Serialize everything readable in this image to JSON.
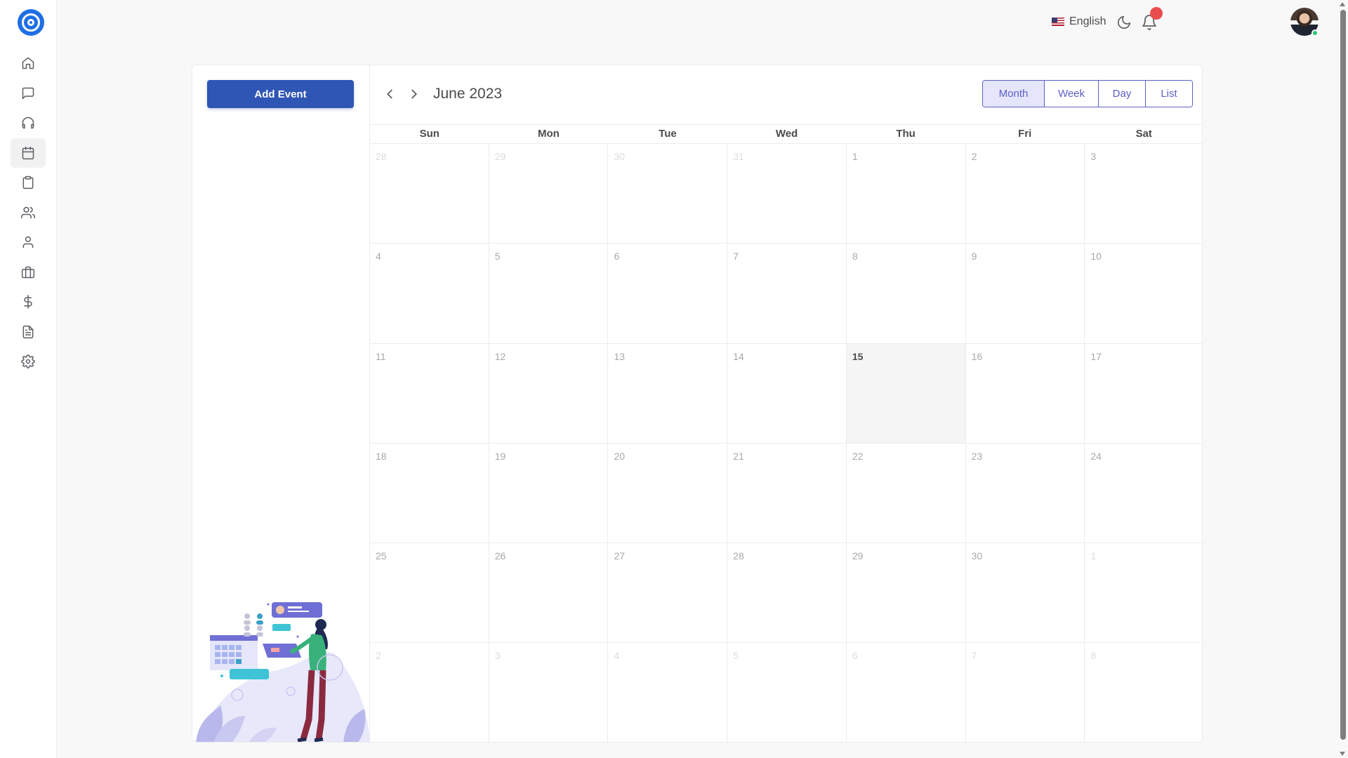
{
  "sidebar": {
    "items": [
      {
        "icon": "home-icon",
        "active": false
      },
      {
        "icon": "chat-icon",
        "active": false
      },
      {
        "icon": "headphones-icon",
        "active": false
      },
      {
        "icon": "calendar-icon",
        "active": true
      },
      {
        "icon": "clipboard-icon",
        "active": false
      },
      {
        "icon": "users-icon",
        "active": false
      },
      {
        "icon": "user-icon",
        "active": false
      },
      {
        "icon": "briefcase-icon",
        "active": false
      },
      {
        "icon": "dollar-icon",
        "active": false
      },
      {
        "icon": "file-text-icon",
        "active": false
      },
      {
        "icon": "settings-icon",
        "active": false
      }
    ]
  },
  "header": {
    "language": "English",
    "colors": {
      "notification_badge": "#ea4d4d",
      "online_status": "#28c76f"
    }
  },
  "left_panel": {
    "add_event_label": "Add Event",
    "colors": {
      "primary_button": "#2f55b5"
    }
  },
  "calendar": {
    "title": "June 2023",
    "views": [
      {
        "label": "Month",
        "active": true
      },
      {
        "label": "Week",
        "active": false
      },
      {
        "label": "Day",
        "active": false
      },
      {
        "label": "List",
        "active": false
      }
    ],
    "days_of_week": [
      "Sun",
      "Mon",
      "Tue",
      "Wed",
      "Thu",
      "Fri",
      "Sat"
    ],
    "weeks": [
      [
        {
          "n": "28",
          "other": true
        },
        {
          "n": "29",
          "other": true
        },
        {
          "n": "30",
          "other": true
        },
        {
          "n": "31",
          "other": true
        },
        {
          "n": "1"
        },
        {
          "n": "2"
        },
        {
          "n": "3"
        }
      ],
      [
        {
          "n": "4"
        },
        {
          "n": "5"
        },
        {
          "n": "6"
        },
        {
          "n": "7"
        },
        {
          "n": "8"
        },
        {
          "n": "9"
        },
        {
          "n": "10"
        }
      ],
      [
        {
          "n": "11"
        },
        {
          "n": "12"
        },
        {
          "n": "13"
        },
        {
          "n": "14"
        },
        {
          "n": "15",
          "today": true
        },
        {
          "n": "16"
        },
        {
          "n": "17"
        }
      ],
      [
        {
          "n": "18"
        },
        {
          "n": "19"
        },
        {
          "n": "20"
        },
        {
          "n": "21"
        },
        {
          "n": "22"
        },
        {
          "n": "23"
        },
        {
          "n": "24"
        }
      ],
      [
        {
          "n": "25"
        },
        {
          "n": "26"
        },
        {
          "n": "27"
        },
        {
          "n": "28"
        },
        {
          "n": "29"
        },
        {
          "n": "30"
        },
        {
          "n": "1",
          "other": true
        }
      ],
      [
        {
          "n": "2",
          "other": true
        },
        {
          "n": "3",
          "other": true
        },
        {
          "n": "4",
          "other": true
        },
        {
          "n": "5",
          "other": true
        },
        {
          "n": "6",
          "other": true
        },
        {
          "n": "7",
          "other": true
        },
        {
          "n": "8",
          "other": true
        }
      ]
    ],
    "colors": {
      "accent": "#5d5fc7",
      "active_view_bg": "#e5e5fb",
      "today_bg": "#f5f5f5"
    }
  }
}
